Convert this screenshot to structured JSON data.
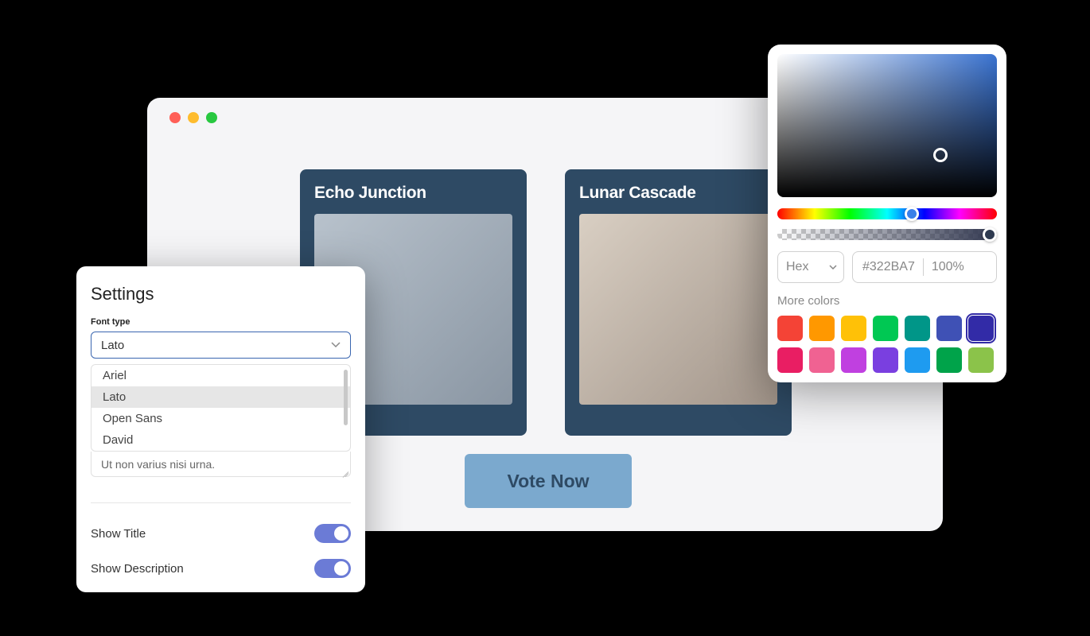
{
  "browser": {
    "cards": [
      {
        "title": "Echo Junction"
      },
      {
        "title": "Lunar Cascade"
      }
    ],
    "vote_label": "Vote Now"
  },
  "settings": {
    "title": "Settings",
    "font_type_label": "Font type",
    "font_selected": "Lato",
    "font_options": [
      "Ariel",
      "Lato",
      "Open Sans",
      "David"
    ],
    "placeholder_text": "Ut non varius nisi urna.",
    "toggles": [
      {
        "label": "Show Title",
        "on": true
      },
      {
        "label": "Show Description",
        "on": true
      }
    ]
  },
  "color_picker": {
    "format_label": "Hex",
    "hex_value": "#322BA7",
    "opacity": "100%",
    "more_colors_label": "More colors",
    "swatches": [
      "#f44336",
      "#ff9800",
      "#ffc107",
      "#00c853",
      "#009688",
      "#3f51b5",
      "#322BA7",
      "#e91e63",
      "#f06292",
      "#c040e0",
      "#7a3fe0",
      "#1e9bf0",
      "#00a34a",
      "#8bc34a"
    ],
    "selected_swatch_index": 6
  }
}
